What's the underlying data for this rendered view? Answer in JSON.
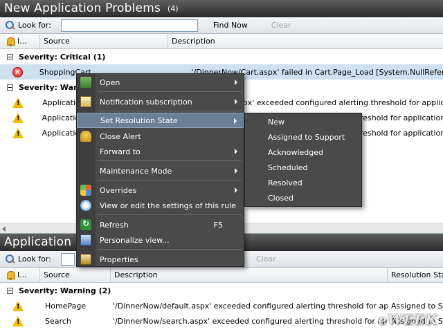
{
  "top_panel": {
    "title": "New Application Problems",
    "count": "(4)",
    "look_for_label": "Look for:",
    "find_now": "Find Now",
    "clear": "Clear",
    "columns": [
      "I...",
      "Source",
      "Description"
    ],
    "groups": [
      {
        "label": "Severity: Critical (1)",
        "rows": [
          {
            "icon": "error-icon",
            "source": "ShoppingCart",
            "description": "'/DinnerNow/Cart.aspx' failed in Cart.Page_Load [System.NullReferenceException]"
          }
        ]
      },
      {
        "label": "Severity: Warning",
        "rows": [
          {
            "icon": "warning-icon",
            "source": "Application",
            "description": ".aspx' exceeded configured alerting threshold for application"
          },
          {
            "icon": "warning-icon",
            "source": "Application",
            "description": "threshold for application D"
          },
          {
            "icon": "warning-icon",
            "source": "Application",
            "description": "threshold for application D"
          }
        ]
      }
    ]
  },
  "bottom_panel": {
    "title": "Application I",
    "look_for_label": "Look for:",
    "clear": "Clear",
    "columns": [
      "I...",
      "Source",
      "Description",
      "Resolution Stat"
    ],
    "group_label": "Severity: Warning (2)",
    "rows": [
      {
        "icon": "warning-icon",
        "source": "HomePage",
        "description": "'/DinnerNow/default.aspx' exceeded configured alerting threshold for applicati...",
        "resolution": "Assigned to Sup"
      },
      {
        "icon": "warning-icon",
        "source": "Search",
        "description": "'/DinnerNow/search.aspx' exceeded configured alerting threshold for applicatio...",
        "resolution": "Assigned to Sup"
      }
    ]
  },
  "context_menu": {
    "items": [
      {
        "label": "Open",
        "icon": "open-icon",
        "submenu": true
      },
      {
        "label": "Notification subscription",
        "icon": "notification-icon",
        "submenu": true
      },
      {
        "label": "Set Resolution State",
        "icon": "",
        "submenu": true,
        "highlighted": true
      },
      {
        "label": "Close Alert",
        "icon": "bell-icon",
        "submenu": false
      },
      {
        "label": "Forward to",
        "icon": "",
        "submenu": true
      },
      {
        "label": "Maintenance Mode",
        "icon": "",
        "submenu": true
      },
      {
        "label": "Overrides",
        "icon": "overrides-icon",
        "submenu": true
      },
      {
        "label": "View or edit the settings of this rule",
        "icon": "settings-icon",
        "submenu": false
      },
      {
        "label": "Refresh",
        "icon": "refresh-icon",
        "shortcut": "F5",
        "submenu": false
      },
      {
        "label": "Personalize view...",
        "icon": "personalize-icon",
        "submenu": false
      },
      {
        "label": "Properties",
        "icon": "properties-icon",
        "submenu": false
      }
    ]
  },
  "resolution_submenu": {
    "items": [
      "New",
      "Assigned to Support",
      "Acknowledged",
      "Scheduled",
      "Resolved",
      "Closed"
    ]
  },
  "watermark": "eWEEK",
  "colors": {
    "titlebar": "#3a3a3a",
    "menu_bg": "#4a4a4a",
    "menu_highlight": "#6b7f96",
    "selected_row": "#cfe0f1"
  }
}
